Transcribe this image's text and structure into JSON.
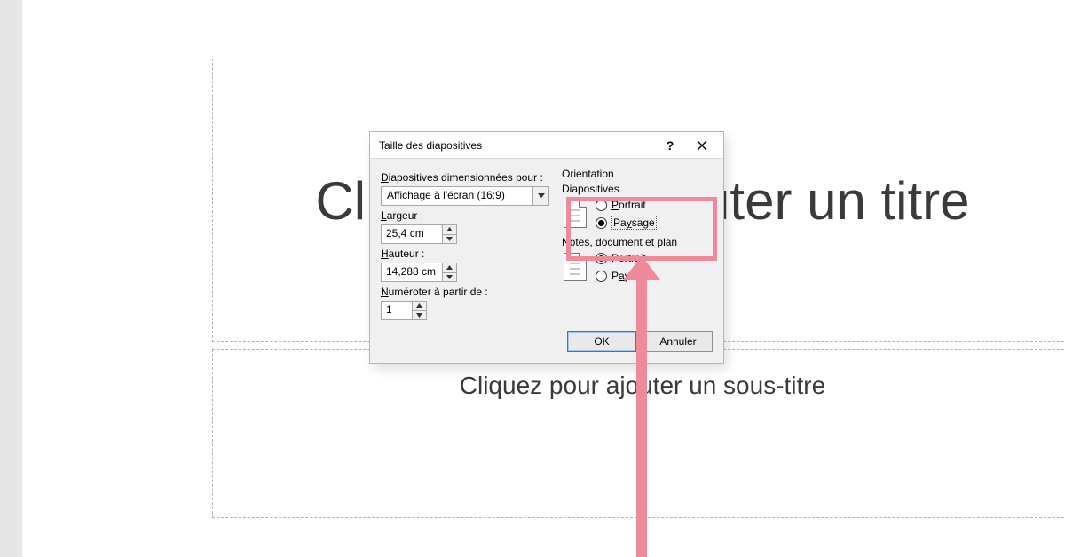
{
  "slide": {
    "title_placeholder": "Cliquez pour ajouter un titre",
    "subtitle_placeholder": "Cliquez pour ajouter un sous-titre"
  },
  "dialog": {
    "title": "Taille des diapositives",
    "help_symbol": "?",
    "sized_for_label": "Diapositives dimensionnées pour :",
    "sized_for_value": "Affichage à l'écran (16:9)",
    "width_label": "Largeur :",
    "width_value": "25,4 cm",
    "height_label": "Hauteur :",
    "height_value": "14,288 cm",
    "number_from_label": "Numéroter à partir de :",
    "number_from_value": "1",
    "orientation_label": "Orientation",
    "slides_group": "Diapositives",
    "notes_group": "Notes, document et plan",
    "option_portrait": "Portrait",
    "option_paysage": "Paysage",
    "slides_selected": "paysage",
    "notes_selected": "portrait",
    "ok": "OK",
    "cancel": "Annuler"
  }
}
